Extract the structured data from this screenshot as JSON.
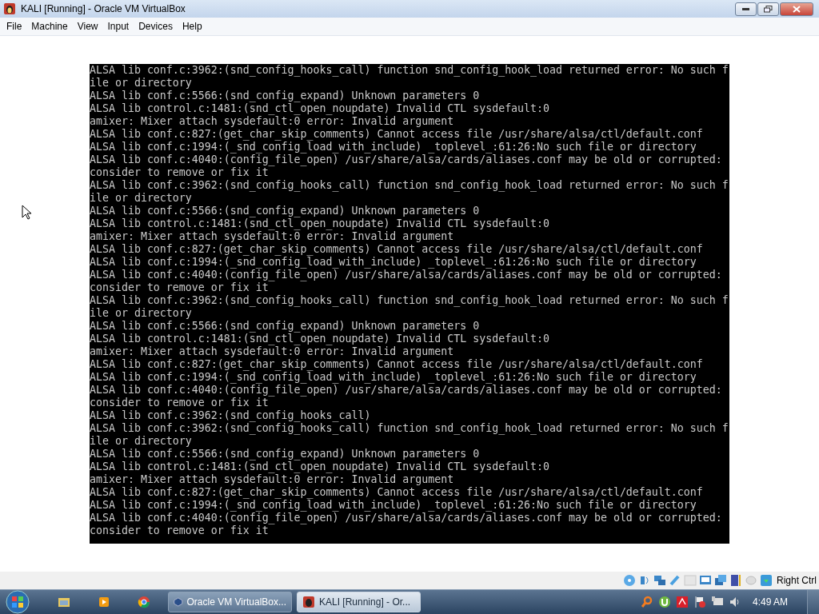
{
  "window": {
    "title": "KALI [Running] - Oracle VM VirtualBox"
  },
  "menu": [
    "File",
    "Machine",
    "View",
    "Input",
    "Devices",
    "Help"
  ],
  "terminal": {
    "lines": [
      "ALSA lib conf.c:3962:(snd_config_hooks_call) function snd_config_hook_load returned error: No such f",
      "ile or directory",
      "ALSA lib conf.c:5566:(snd_config_expand) Unknown parameters 0",
      "ALSA lib control.c:1481:(snd_ctl_open_noupdate) Invalid CTL sysdefault:0",
      "amixer: Mixer attach sysdefault:0 error: Invalid argument",
      "ALSA lib conf.c:827:(get_char_skip_comments) Cannot access file /usr/share/alsa/ctl/default.conf",
      "ALSA lib conf.c:1994:(_snd_config_load_with_include) _toplevel_:61:26:No such file or directory",
      "ALSA lib conf.c:4040:(config_file_open) /usr/share/alsa/cards/aliases.conf may be old or corrupted:",
      "consider to remove or fix it",
      "ALSA lib conf.c:3962:(snd_config_hooks_call) function snd_config_hook_load returned error: No such f",
      "ile or directory",
      "ALSA lib conf.c:5566:(snd_config_expand) Unknown parameters 0",
      "ALSA lib control.c:1481:(snd_ctl_open_noupdate) Invalid CTL sysdefault:0",
      "amixer: Mixer attach sysdefault:0 error: Invalid argument",
      "ALSA lib conf.c:827:(get_char_skip_comments) Cannot access file /usr/share/alsa/ctl/default.conf",
      "ALSA lib conf.c:1994:(_snd_config_load_with_include) _toplevel_:61:26:No such file or directory",
      "ALSA lib conf.c:4040:(config_file_open) /usr/share/alsa/cards/aliases.conf may be old or corrupted:",
      "consider to remove or fix it",
      "ALSA lib conf.c:3962:(snd_config_hooks_call) function snd_config_hook_load returned error: No such f",
      "ile or directory",
      "ALSA lib conf.c:5566:(snd_config_expand) Unknown parameters 0",
      "ALSA lib control.c:1481:(snd_ctl_open_noupdate) Invalid CTL sysdefault:0",
      "amixer: Mixer attach sysdefault:0 error: Invalid argument",
      "ALSA lib conf.c:827:(get_char_skip_comments) Cannot access file /usr/share/alsa/ctl/default.conf",
      "ALSA lib conf.c:1994:(_snd_config_load_with_include) _toplevel_:61:26:No such file or directory",
      "ALSA lib conf.c:4040:(config_file_open) /usr/share/alsa/cards/aliases.conf may be old or corrupted:",
      "consider to remove or fix it",
      "ALSA lib conf.c:3962:(snd_config_hooks_call)",
      "ALSA lib conf.c:3962:(snd_config_hooks_call) function snd_config_hook_load returned error: No such f",
      "ile or directory",
      "ALSA lib conf.c:5566:(snd_config_expand) Unknown parameters 0",
      "ALSA lib control.c:1481:(snd_ctl_open_noupdate) Invalid CTL sysdefault:0",
      "amixer: Mixer attach sysdefault:0 error: Invalid argument",
      "ALSA lib conf.c:827:(get_char_skip_comments) Cannot access file /usr/share/alsa/ctl/default.conf",
      "ALSA lib conf.c:1994:(_snd_config_load_with_include) _toplevel_:61:26:No such file or directory",
      "ALSA lib conf.c:4040:(config_file_open) /usr/share/alsa/cards/aliases.conf may be old or corrupted:",
      "consider to remove or fix it"
    ]
  },
  "status_bar": {
    "host_key": "Right Ctrl"
  },
  "taskbar": {
    "tasks": [
      {
        "label": "Oracle VM VirtualBox...",
        "selected": false
      },
      {
        "label": "KALI [Running] - Or...",
        "selected": true
      }
    ],
    "clock": "4:49 AM"
  }
}
